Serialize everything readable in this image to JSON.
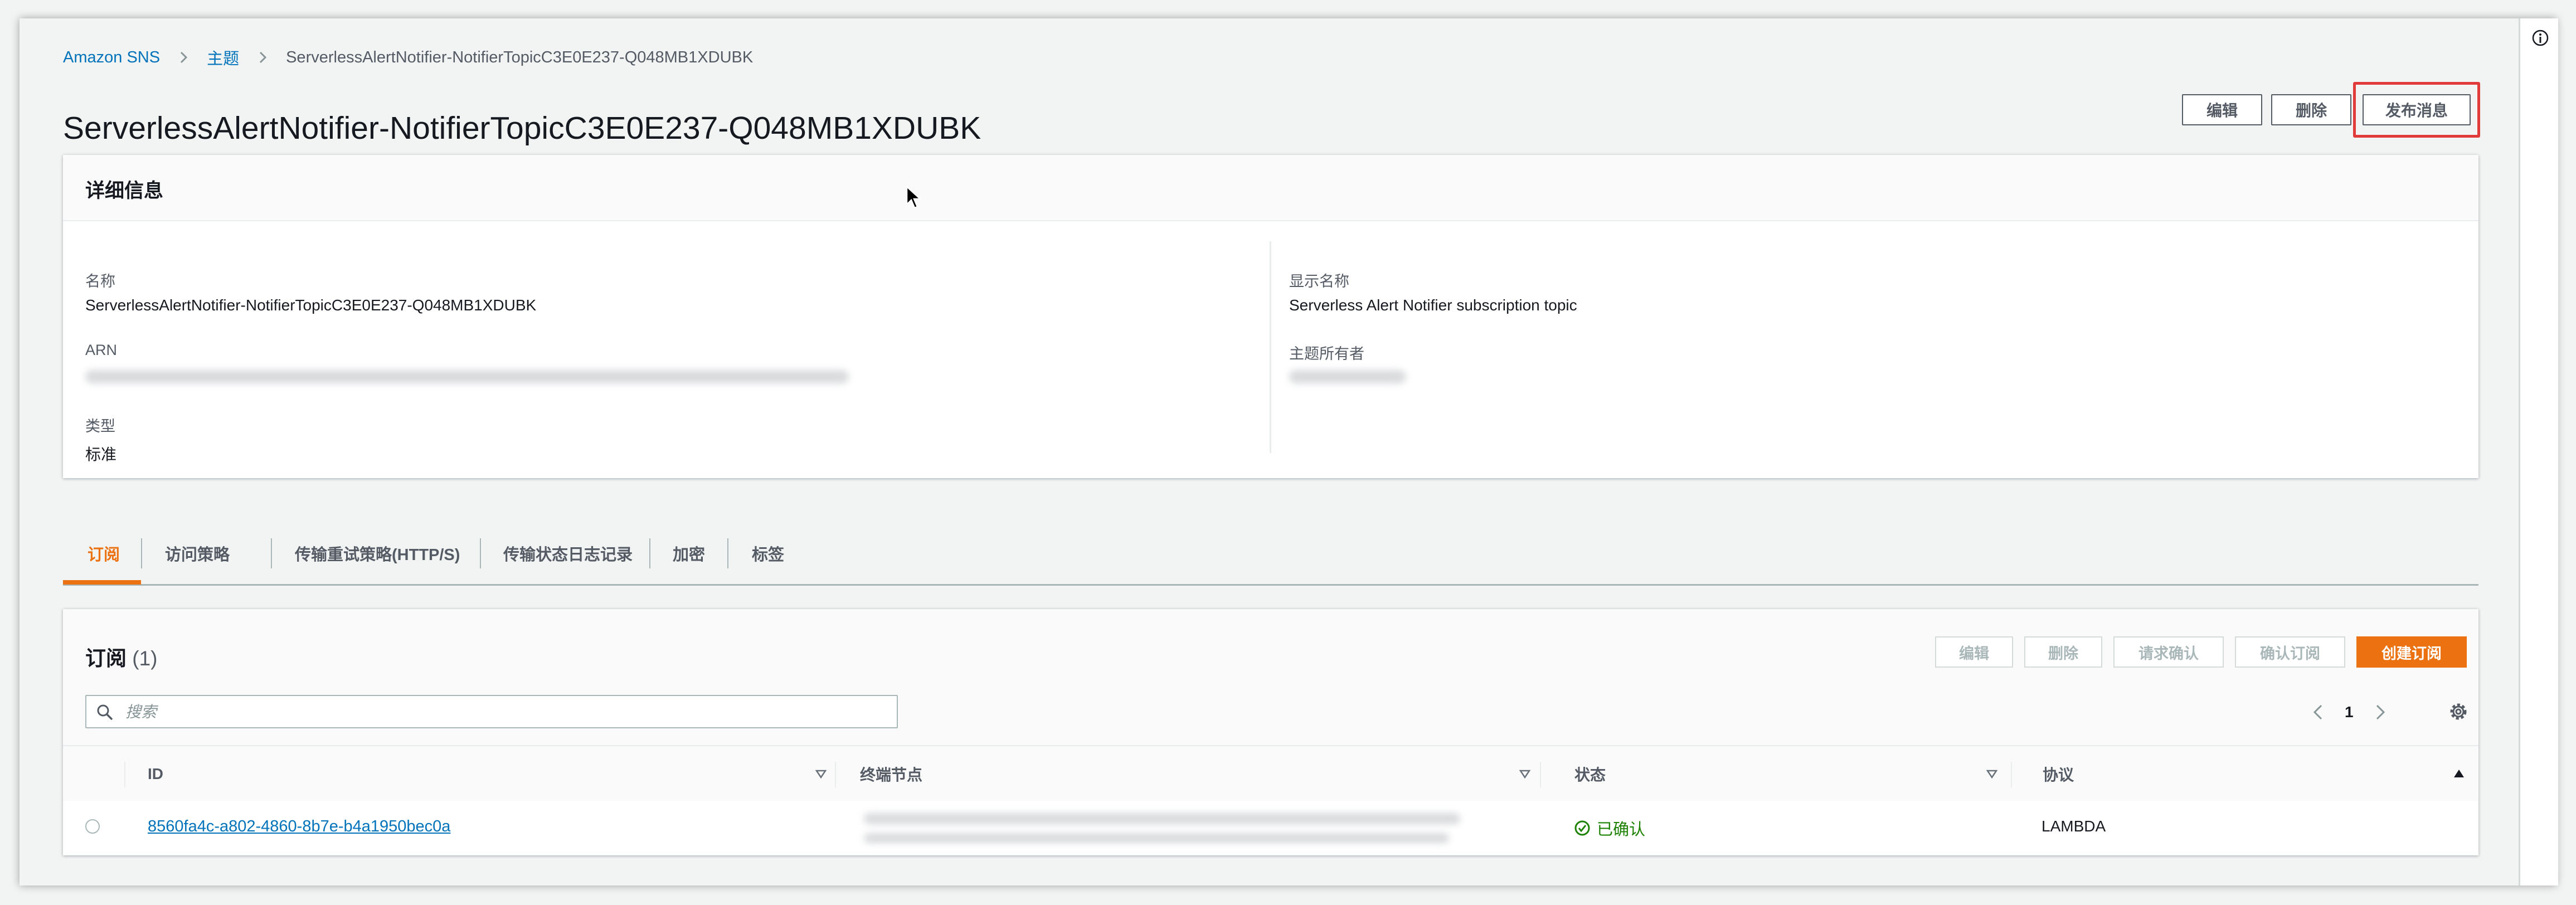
{
  "breadcrumb": {
    "service": "Amazon SNS",
    "topics": "主题",
    "current": "ServerlessAlertNotifier-NotifierTopicC3E0E237-Q048MB1XDUBK"
  },
  "page": {
    "title": "ServerlessAlertNotifier-NotifierTopicC3E0E237-Q048MB1XDUBK",
    "buttons": {
      "edit": "编辑",
      "delete": "删除",
      "publish": "发布消息"
    }
  },
  "details": {
    "title": "详细信息",
    "name_label": "名称",
    "name_value": "ServerlessAlertNotifier-NotifierTopicC3E0E237-Q048MB1XDUBK",
    "arn_label": "ARN",
    "type_label": "类型",
    "type_value": "标准",
    "display_name_label": "显示名称",
    "display_name_value": "Serverless Alert Notifier subscription topic",
    "owner_label": "主题所有者"
  },
  "tabs": [
    {
      "label": "订阅",
      "active": true
    },
    {
      "label": "访问策略",
      "active": false
    },
    {
      "label": "传输重试策略(HTTP/S)",
      "active": false
    },
    {
      "label": "传输状态日志记录",
      "active": false
    },
    {
      "label": "加密",
      "active": false
    },
    {
      "label": "标签",
      "active": false
    }
  ],
  "subscriptions": {
    "title": "订阅",
    "count": "(1)",
    "buttons": {
      "edit": "编辑",
      "delete": "删除",
      "request_confirm": "请求确认",
      "confirm": "确认订阅",
      "create": "创建订阅"
    },
    "search_placeholder": "搜索",
    "page_number": "1",
    "columns": {
      "id": "ID",
      "endpoint": "终端节点",
      "status": "状态",
      "protocol": "协议"
    },
    "rows": [
      {
        "id": "8560fa4c-a802-4860-8b7e-b4a1950bec0a",
        "status": "已确认",
        "protocol": "LAMBDA"
      }
    ]
  },
  "colors": {
    "link": "#0073bb",
    "accent": "#ec7211",
    "success": "#1d8102",
    "highlight": "#e03a3a"
  }
}
